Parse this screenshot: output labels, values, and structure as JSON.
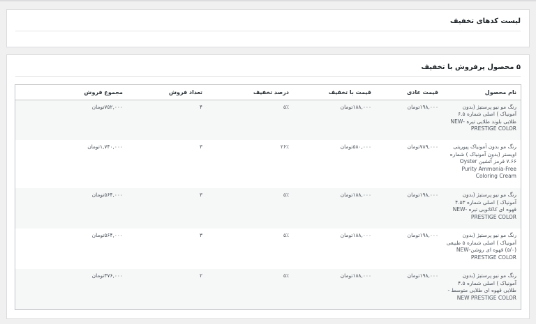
{
  "coupons_panel": {
    "title": "لیست کدهای تخفیف"
  },
  "top_products": {
    "title": "۵ محصول پرفروش با تخفیف",
    "columns": [
      "نام محصول",
      "قیمت عادی",
      "قیمت با تخفیف",
      "درصد تخفیف",
      "تعداد فروش",
      "مجموع فروش"
    ],
    "rows": [
      {
        "name": "رنگ مو نیو پرستیژ (بدون آمونیاک ) اصلی شماره ۶.۵ طلایی بلوند طلایی تیره -NEW PRESTIGE COLOR",
        "regular": "۱۹۸,۰۰۰تومان",
        "discounted": "۱۸۸,۰۰۰تومان",
        "percent": "۵٪",
        "qty": "۴",
        "total": "۷۵۲,۰۰۰تومان"
      },
      {
        "name": "رنگ مو بدون آمونیاک پیوریتی اویستر (بدون آمونیاک ) شماره ۷.۶۶ قرمز آتشین Oyster Purity Ammonia-Free Coloring Cream",
        "regular": "۷۸۹,۰۰۰تومان",
        "discounted": "۵۸۰,۰۰۰تومان",
        "percent": "۲۶٪",
        "qty": "۳",
        "total": "۱,۷۴۰,۰۰۰تومان"
      },
      {
        "name": "رنگ مو نیو پرستیژ (بدون آمونیاک ) اصلی شماره ۴.۵۳ قهوه ای کاکائویی تیره -NEW PRESTIGE COLOR",
        "regular": "۱۹۸,۰۰۰تومان",
        "discounted": "۱۸۸,۰۰۰تومان",
        "percent": "۵٪",
        "qty": "۳",
        "total": "۵۶۴,۰۰۰تومان"
      },
      {
        "name": "رنگ مو نیو پرستیژ (بدون آمونیاک ) اصلی شماره ۵ طبیعی (۵/۰) قهوه ای روشن-NEW PRESTIGE COLOR",
        "regular": "۱۹۸,۰۰۰تومان",
        "discounted": "۱۸۸,۰۰۰تومان",
        "percent": "۵٪",
        "qty": "۳",
        "total": "۵۶۴,۰۰۰تومان"
      },
      {
        "name": "رنگ مو نیو پرستیژ (بدون آمونیاک ) اصلی شماره ۴.۵ طلایی قهوه ای طلایی متوسط -NEW PRESTIGE COLOR",
        "regular": "۱۹۸,۰۰۰تومان",
        "discounted": "۱۸۸,۰۰۰تومان",
        "percent": "۵٪",
        "qty": "۲",
        "total": "۳۷۶,۰۰۰تومان"
      }
    ]
  }
}
